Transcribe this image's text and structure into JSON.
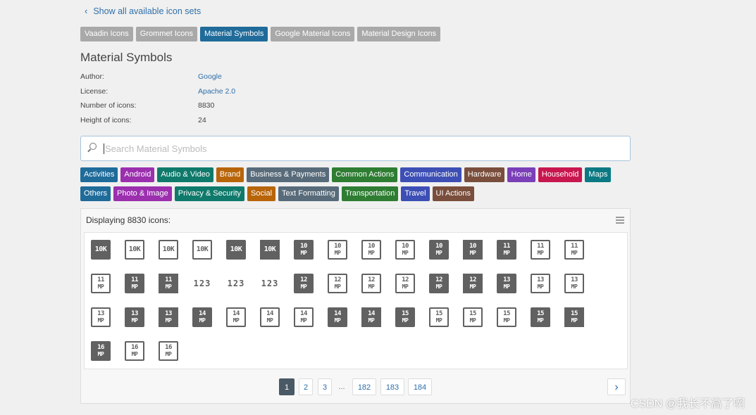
{
  "back_link": "Show all available icon sets",
  "icon_sets": [
    {
      "label": "Vaadin Icons",
      "active": false
    },
    {
      "label": "Grommet Icons",
      "active": false
    },
    {
      "label": "Material Symbols",
      "active": true
    },
    {
      "label": "Google Material Icons",
      "active": false
    },
    {
      "label": "Material Design Icons",
      "active": false
    }
  ],
  "title": "Material Symbols",
  "meta": [
    {
      "key": "Author:",
      "value": "Google",
      "link": true
    },
    {
      "key": "License:",
      "value": "Apache 2.0",
      "link": true
    },
    {
      "key": "Number of icons:",
      "value": "8830",
      "link": false
    },
    {
      "key": "Height of icons:",
      "value": "24",
      "link": false
    }
  ],
  "search": {
    "placeholder": "Search Material Symbols",
    "icon": "search-icon"
  },
  "categories": [
    [
      {
        "label": "Activities",
        "color": "#1f6b9a"
      },
      {
        "label": "Android",
        "color": "#9b2fae"
      },
      {
        "label": "Audio & Video",
        "color": "#0f7a6b"
      },
      {
        "label": "Brand",
        "color": "#b8650a"
      },
      {
        "label": "Business & Payments",
        "color": "#586b7a"
      },
      {
        "label": "Common Actions",
        "color": "#2e7d32"
      },
      {
        "label": "Communication",
        "color": "#3d4fb5"
      },
      {
        "label": "Hardware",
        "color": "#7a4e3c"
      },
      {
        "label": "Home",
        "color": "#7b3fb8"
      },
      {
        "label": "Household",
        "color": "#c8174f"
      },
      {
        "label": "Maps",
        "color": "#0b7983"
      }
    ],
    [
      {
        "label": "Others",
        "color": "#1f6b9a"
      },
      {
        "label": "Photo & Image",
        "color": "#9b2fae"
      },
      {
        "label": "Privacy & Security",
        "color": "#0f7a6b"
      },
      {
        "label": "Social",
        "color": "#b8650a"
      },
      {
        "label": "Text Formatting",
        "color": "#586b7a"
      },
      {
        "label": "Transportation",
        "color": "#2e7d32"
      },
      {
        "label": "Travel",
        "color": "#3d4fb5"
      },
      {
        "label": "UI Actions",
        "color": "#7a4e3c"
      }
    ]
  ],
  "display_count": "Displaying 8830 icons:",
  "icons": [
    {
      "name": "10k",
      "style": "filled"
    },
    {
      "name": "10k",
      "style": "outlined"
    },
    {
      "name": "10k",
      "style": "outlined"
    },
    {
      "name": "10k",
      "style": "outlined"
    },
    {
      "name": "10k",
      "style": "filled"
    },
    {
      "name": "10k",
      "style": "sharp"
    },
    {
      "name": "10mp",
      "style": "filled"
    },
    {
      "name": "10mp",
      "style": "outlined"
    },
    {
      "name": "10mp",
      "style": "outlined"
    },
    {
      "name": "10mp",
      "style": "outlined"
    },
    {
      "name": "10mp",
      "style": "filled"
    },
    {
      "name": "10mp",
      "style": "sharp"
    },
    {
      "name": "11mp",
      "style": "filled"
    },
    {
      "name": "11mp",
      "style": "outlined"
    },
    {
      "name": "11mp",
      "style": "outlined"
    },
    {
      "name": "11mp",
      "style": "outlined"
    },
    {
      "name": "11mp",
      "style": "filled"
    },
    {
      "name": "11mp",
      "style": "sharp"
    },
    {
      "name": "123",
      "style": "plain"
    },
    {
      "name": "123",
      "style": "plain"
    },
    {
      "name": "123",
      "style": "plain"
    },
    {
      "name": "12mp",
      "style": "filled"
    },
    {
      "name": "12mp",
      "style": "outlined"
    },
    {
      "name": "12mp",
      "style": "outlined"
    },
    {
      "name": "12mp",
      "style": "outlined"
    },
    {
      "name": "12mp",
      "style": "filled"
    },
    {
      "name": "12mp",
      "style": "sharp"
    },
    {
      "name": "13mp",
      "style": "filled"
    },
    {
      "name": "13mp",
      "style": "outlined"
    },
    {
      "name": "13mp",
      "style": "outlined"
    },
    {
      "name": "13mp",
      "style": "outlined"
    },
    {
      "name": "13mp",
      "style": "filled"
    },
    {
      "name": "13mp",
      "style": "sharp"
    },
    {
      "name": "14mp",
      "style": "filled"
    },
    {
      "name": "14mp",
      "style": "outlined"
    },
    {
      "name": "14mp",
      "style": "outlined"
    },
    {
      "name": "14mp",
      "style": "outlined"
    },
    {
      "name": "14mp",
      "style": "filled"
    },
    {
      "name": "14mp",
      "style": "sharp"
    },
    {
      "name": "15mp",
      "style": "filled"
    },
    {
      "name": "15mp",
      "style": "outlined"
    },
    {
      "name": "15mp",
      "style": "outlined"
    },
    {
      "name": "15mp",
      "style": "outlined"
    },
    {
      "name": "15mp",
      "style": "filled"
    },
    {
      "name": "15mp",
      "style": "sharp"
    },
    {
      "name": "16mp",
      "style": "filled"
    },
    {
      "name": "16mp",
      "style": "outlined"
    },
    {
      "name": "16mp",
      "style": "outlined"
    }
  ],
  "pagination": {
    "pages": [
      {
        "label": "1",
        "active": true
      },
      {
        "label": "2",
        "active": false
      },
      {
        "label": "3",
        "active": false
      },
      {
        "label": "...",
        "active": false,
        "dots": true
      },
      {
        "label": "182",
        "active": false
      },
      {
        "label": "183",
        "active": false
      },
      {
        "label": "184",
        "active": false
      }
    ],
    "next_icon": "chevron-right-icon"
  },
  "watermark": "CSDN @我长不高了啊"
}
